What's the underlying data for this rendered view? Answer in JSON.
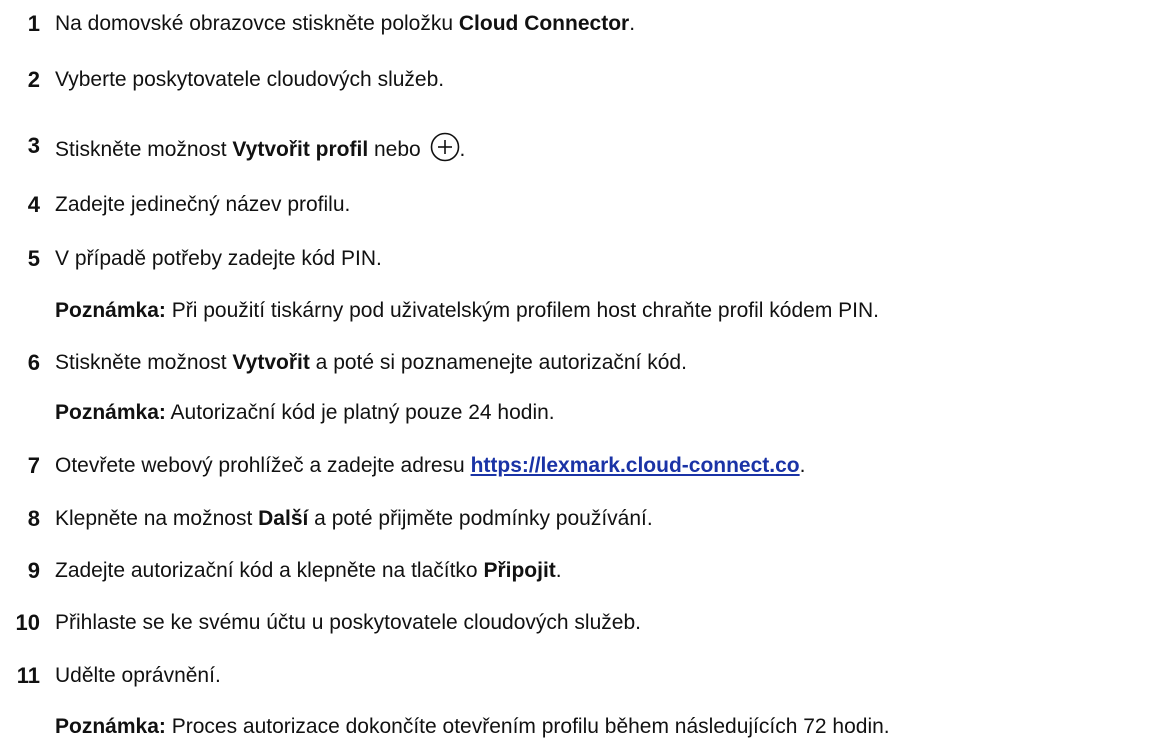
{
  "steps": [
    {
      "num": "1",
      "pre": "Na domovské obrazovce stiskněte položku ",
      "bold": "Cloud Connector",
      "post": "."
    },
    {
      "num": "2",
      "text": "Vyberte poskytovatele cloudových služeb."
    },
    {
      "num": "3",
      "pre": "Stiskněte možnost ",
      "bold": "Vytvořit profil",
      "mid": " nebo ",
      "icon": "plus-circle-icon",
      "post": "."
    },
    {
      "num": "4",
      "text": "Zadejte jedinečný název profilu."
    },
    {
      "num": "5",
      "text": "V případě potřeby zadejte kód PIN."
    },
    {
      "num": "6",
      "pre": "Stiskněte možnost ",
      "bold": "Vytvořit",
      "post": " a poté si poznamenejte autorizační kód."
    },
    {
      "num": "7",
      "pre": "Otevřete webový prohlížeč a zadejte adresu ",
      "link": "https://lexmark.cloud-connect.co",
      "post": "."
    },
    {
      "num": "8",
      "pre": "Klepněte na možnost ",
      "bold": "Další",
      "post": " a poté přijměte podmínky používání."
    },
    {
      "num": "9",
      "pre": "Zadejte autorizační kód a klepněte na tlačítko ",
      "bold": "Připojit",
      "post": "."
    },
    {
      "num": "10",
      "text": "Přihlaste se ke svému účtu u poskytovatele cloudových služeb."
    },
    {
      "num": "11",
      "text": "Udělte oprávnění."
    }
  ],
  "notes": {
    "label": "Poznámka:",
    "note5": " Při použití tiskárny pod uživatelským profilem host chraňte profil kódem PIN.",
    "note6": " Autorizační kód je platný pouze 24 hodin.",
    "note11": " Proces autorizace dokončíte otevřením profilu během následujících 72 hodin."
  }
}
